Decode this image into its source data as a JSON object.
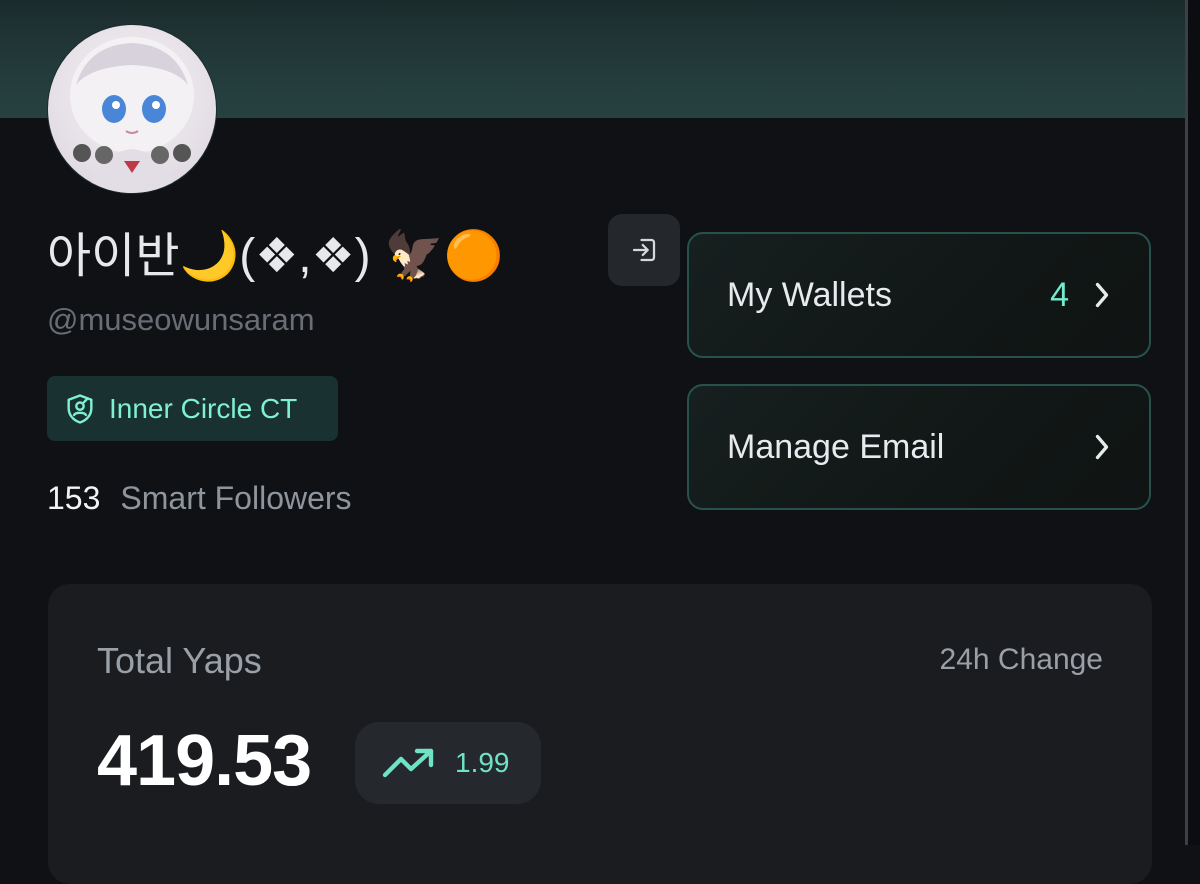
{
  "profile": {
    "display_name": "아이반🌙(❖,❖) 🦅🟠",
    "handle": "@museowunsaram",
    "badge": {
      "label": "Inner Circle CT",
      "icon": "shield-user-icon"
    },
    "smart_followers": {
      "count": "153",
      "label": "Smart Followers"
    }
  },
  "actions": {
    "logout_icon": "logout-icon",
    "wallets": {
      "label": "My Wallets",
      "count": "4",
      "icon": "chevron-right-icon"
    },
    "email": {
      "label": "Manage Email",
      "icon": "chevron-right-icon"
    }
  },
  "yaps": {
    "title": "Total Yaps",
    "change_label": "24h Change",
    "value": "419.53",
    "change_value": "1.99",
    "trend_icon": "trending-up-icon"
  },
  "colors": {
    "accent": "#76ead0",
    "background": "#0f1114",
    "card_border": "#26524b"
  }
}
